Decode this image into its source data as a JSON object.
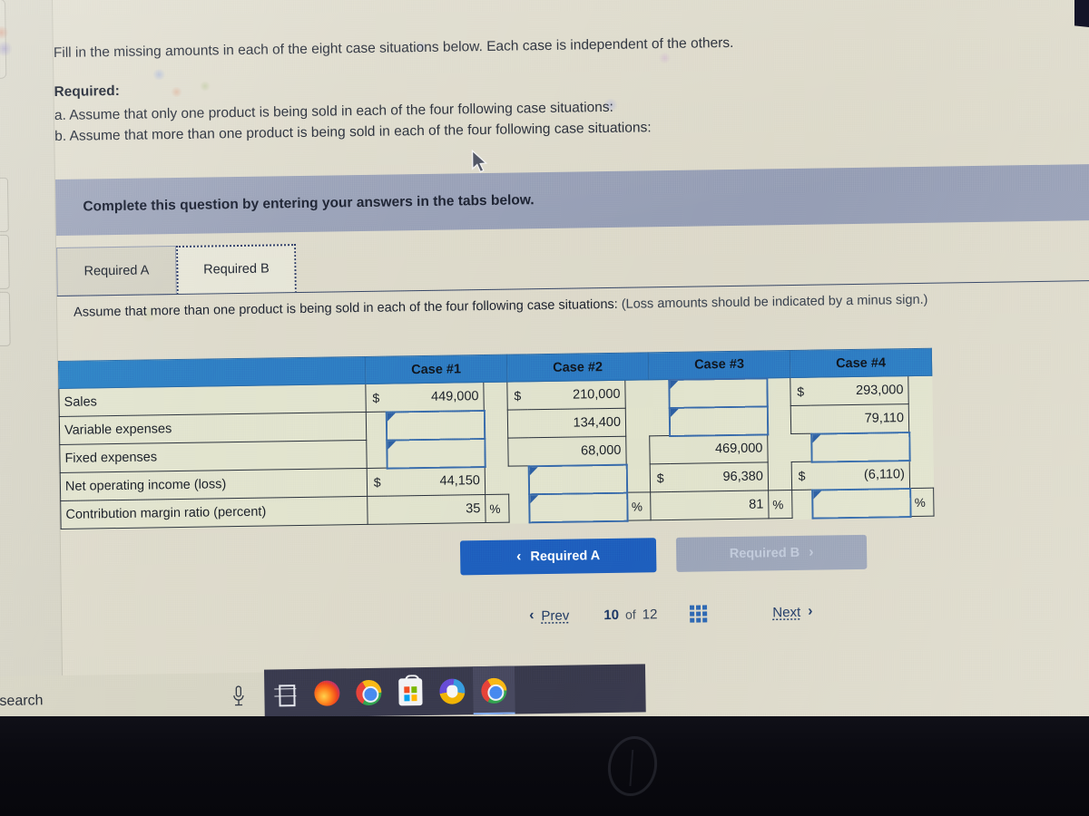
{
  "intro": {
    "line1": "Fill in the missing amounts in each of the eight case situations below. Each case is independent of the others.",
    "required_label": "Required:",
    "item_a": "a. Assume that only one product is being sold in each of the four following case situations:",
    "item_b": "b. Assume that more than one product is being sold in each of the four following case situations:"
  },
  "banner": {
    "text": "Complete this question by entering your answers in the tabs below."
  },
  "tabs": [
    {
      "label": "Required A",
      "selected": false
    },
    {
      "label": "Required B",
      "selected": true
    }
  ],
  "assume": {
    "main": "Assume that more than one product is being sold in each of the four following case situations:",
    "note": "(Loss amounts should be indicated by a minus sign.)"
  },
  "table": {
    "corner_header": "",
    "columns": [
      "Case #1",
      "Case #2",
      "Case #3",
      "Case #4"
    ],
    "rows": [
      {
        "label": "Sales",
        "cells": [
          {
            "currency": "$",
            "value": "449,000",
            "suffix": "",
            "input": false
          },
          {
            "currency": "$",
            "value": "210,000",
            "suffix": "",
            "input": false
          },
          {
            "currency": "",
            "value": "",
            "suffix": "",
            "input": true
          },
          {
            "currency": "$",
            "value": "293,000",
            "suffix": "",
            "input": false
          }
        ]
      },
      {
        "label": "Variable expenses",
        "cells": [
          {
            "currency": "",
            "value": "",
            "suffix": "",
            "input": true
          },
          {
            "currency": "",
            "value": "134,400",
            "suffix": "",
            "input": false
          },
          {
            "currency": "",
            "value": "",
            "suffix": "",
            "input": true
          },
          {
            "currency": "",
            "value": "79,110",
            "suffix": "",
            "input": false
          }
        ]
      },
      {
        "label": "Fixed expenses",
        "cells": [
          {
            "currency": "",
            "value": "",
            "suffix": "",
            "input": true
          },
          {
            "currency": "",
            "value": "68,000",
            "suffix": "",
            "input": false
          },
          {
            "currency": "",
            "value": "469,000",
            "suffix": "",
            "input": false
          },
          {
            "currency": "",
            "value": "",
            "suffix": "",
            "input": true
          }
        ]
      },
      {
        "label": "Net operating income (loss)",
        "cells": [
          {
            "currency": "$",
            "value": "44,150",
            "suffix": "",
            "input": false
          },
          {
            "currency": "",
            "value": "",
            "suffix": "",
            "input": true
          },
          {
            "currency": "$",
            "value": "96,380",
            "suffix": "",
            "input": false
          },
          {
            "currency": "$",
            "value": "(6,110)",
            "suffix": "",
            "input": false
          }
        ]
      },
      {
        "label": "Contribution margin ratio (percent)",
        "cells": [
          {
            "currency": "",
            "value": "35",
            "suffix": "%",
            "input": false
          },
          {
            "currency": "",
            "value": "",
            "suffix": "%",
            "input": true
          },
          {
            "currency": "",
            "value": "81",
            "suffix": "%",
            "input": false
          },
          {
            "currency": "",
            "value": "",
            "suffix": "%",
            "input": true
          }
        ]
      }
    ]
  },
  "nav": {
    "prev_button": {
      "label": "Required A",
      "chevron": "‹",
      "state": "enabled"
    },
    "next_button": {
      "label": "Required B",
      "chevron": "›",
      "state": "disabled"
    }
  },
  "pager": {
    "prev_label": "Prev",
    "prev_chevron": "‹",
    "current_page": "10",
    "of_word": "of",
    "total_pages": "12",
    "grid_icon": "grid-icon",
    "next_label": "Next",
    "next_chevron": "›"
  },
  "taskbar": {
    "search_text": "search",
    "items": [
      {
        "icon": "microphone-icon",
        "active": false
      },
      {
        "icon": "task-view-icon",
        "active": false
      },
      {
        "icon": "firefox-icon",
        "active": false
      },
      {
        "icon": "chrome-icon",
        "active": false
      },
      {
        "icon": "microsoft-store-icon",
        "active": false
      },
      {
        "icon": "browser-icon",
        "active": false
      },
      {
        "icon": "chrome-icon",
        "active": true
      }
    ]
  },
  "colors": {
    "header_blue": "#2f7fc4",
    "banner_grey": "#9aa2b8",
    "button_blue": "#1f63c0",
    "page_bg": "#dedbcc",
    "table_bg": "#e2e4cf",
    "input_border": "#3a6fae"
  }
}
